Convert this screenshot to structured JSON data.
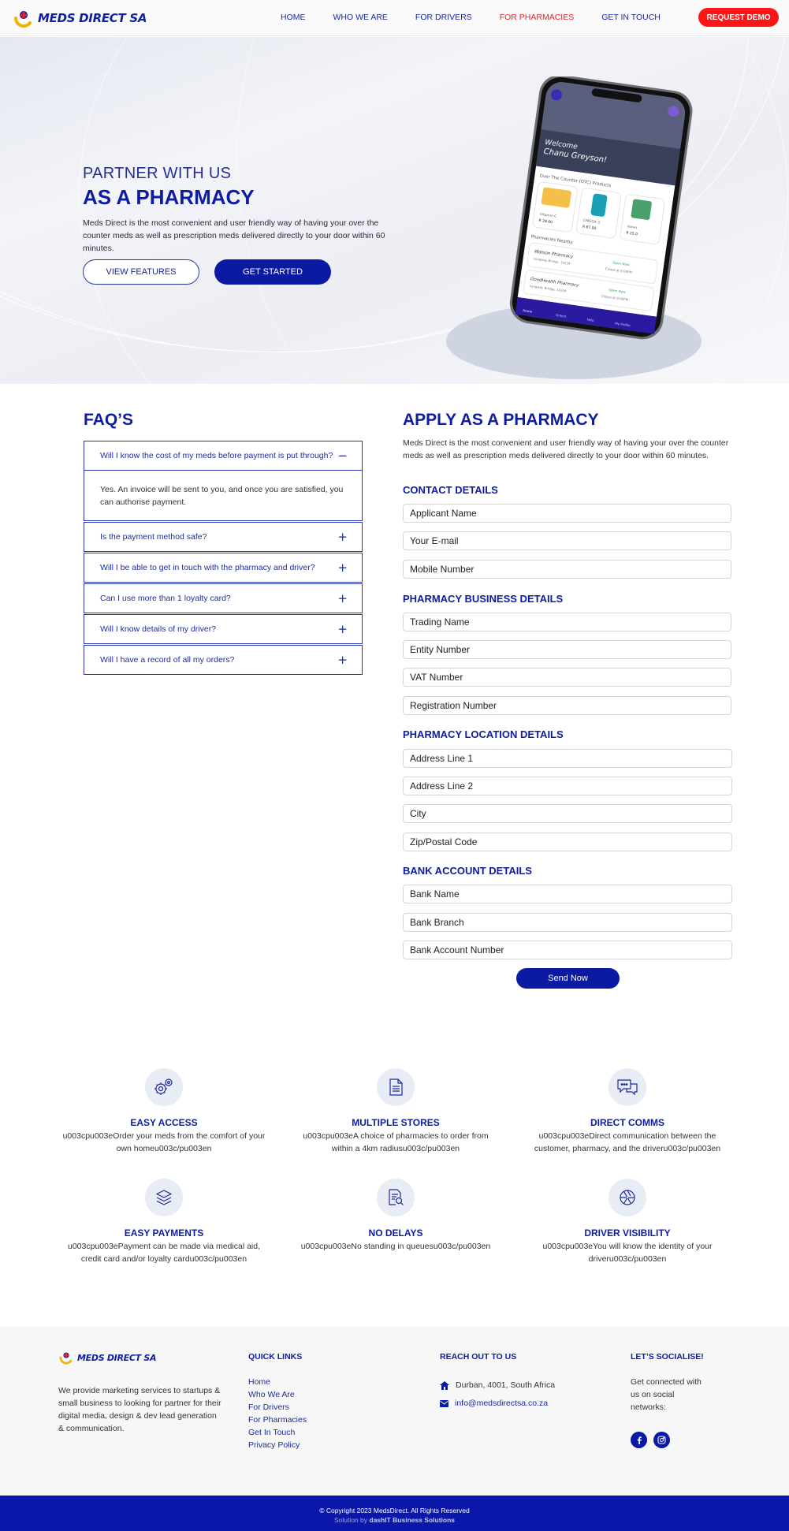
{
  "brand": {
    "name": "MEDS DIRECT SA"
  },
  "nav": {
    "items": [
      {
        "label": "HOME"
      },
      {
        "label": "WHO WE ARE"
      },
      {
        "label": "FOR DRIVERS"
      },
      {
        "label": "FOR PHARMACIES",
        "active": true
      },
      {
        "label": "GET IN TOUCH"
      }
    ],
    "cta": "REQUEST DEMO"
  },
  "hero": {
    "kicker": "PARTNER WITH US",
    "title": "AS A PHARMACY",
    "description": "Meds Direct is the most convenient and user friendly way of having your over the counter meds as well as prescription meds delivered directly to your door within 60 minutes.",
    "btn_features": "VIEW FEATURES",
    "btn_start": "GET STARTED"
  },
  "phone": {
    "welcome": "Welcome",
    "user": "Chanu Greyson!",
    "otc_heading": "Over The Counter (OTC) Products",
    "products": [
      {
        "name": "Vitamin C",
        "price": "R 28.00"
      },
      {
        "name": "OMEGA 3",
        "price": "R 87.00"
      },
      {
        "name": "Voren",
        "price": "R 25.0"
      }
    ],
    "nearby_heading": "Pharmacies Nearby",
    "pharmacies": [
      {
        "name": "Watson Pharmacy",
        "address": "Longway Bridge, 10234",
        "status": "Open Now",
        "closes": "Closes at 8:00PM"
      },
      {
        "name": "GoodHealth Pharmacy",
        "address": "Longway Bridge, 10234",
        "status": "Open Now",
        "closes": "Closes at 8:00PM"
      }
    ],
    "tabs": [
      "Home",
      "Orders",
      "Help",
      "My Profile"
    ]
  },
  "faq": {
    "title": "FAQ’S",
    "items": [
      {
        "q": "Will I know the cost of my meds before payment is put through?",
        "a": "Yes. An invoice will be sent to you, and once you are satisfied, you can authorise payment.",
        "open": true
      },
      {
        "q": "Is the payment method safe?"
      },
      {
        "q": "Will I be able to get in touch with the pharmacy and driver?"
      },
      {
        "q": "Can I use more than 1 loyalty card?"
      },
      {
        "q": "Will I know details of my driver?"
      },
      {
        "q": "Will I have a record of all my orders?"
      }
    ]
  },
  "apply": {
    "title": "APPLY AS A PHARMACY",
    "description": "Meds Direct is the most convenient and user friendly way of having your over the counter meds as well as prescription meds delivered directly to your door within 60 minutes.",
    "sections": [
      {
        "heading": "CONTACT DETAILS",
        "fields": [
          "Applicant Name",
          "Your E-mail",
          "Mobile Number"
        ]
      },
      {
        "heading": "PHARMACY BUSINESS DETAILS",
        "fields": [
          "Trading Name",
          "Entity Number",
          "VAT Number",
          "Registration Number"
        ]
      },
      {
        "heading": "PHARMACY LOCATION DETAILS",
        "fields": [
          "Address Line 1",
          "Address Line 2",
          "City",
          "Zip/Postal Code"
        ]
      },
      {
        "heading": "BANK ACCOUNT DETAILS",
        "fields": [
          "Bank Name",
          "Bank Branch",
          "Bank Account Number"
        ]
      }
    ],
    "submit": "Send Now"
  },
  "features": [
    {
      "icon": "gears-icon",
      "title": "EASY ACCESS",
      "line1": "u003cpu003eOrder your meds from the comfort of your",
      "line2": "own homeu003c/pu003en"
    },
    {
      "icon": "document-icon",
      "title": "MULTIPLE STORES",
      "line1": "u003cpu003eA choice of pharmacies to order from",
      "line2": "within a 4km radiusu003c/pu003en"
    },
    {
      "icon": "chat-icon",
      "title": "DIRECT COMMS",
      "line1": "u003cpu003eDirect communication between the",
      "line2": "customer, pharmacy, and the driveru003c/pu003en"
    },
    {
      "icon": "layers-icon",
      "title": "EASY PAYMENTS",
      "line1": "u003cpu003ePayment can be made via medical aid,",
      "line2": "credit card and/or loyalty cardu003c/pu003en"
    },
    {
      "icon": "search-document-icon",
      "title": "NO DELAYS",
      "line1": "u003cpu003eNo standing in queuesu003c/pu003en",
      "line2": ""
    },
    {
      "icon": "aperture-icon",
      "title": "DRIVER VISIBILITY",
      "line1": "u003cpu003eYou will know the identity of your",
      "line2": "driveru003c/pu003en"
    }
  ],
  "footer": {
    "about": "We provide marketing services to startups & small business to looking for partner for their digital media, design & dev lead generation & communication.",
    "quick_links_heading": "QUICK LINKS",
    "quick_links": [
      "Home",
      "Who We Are",
      "For Drivers",
      "For Pharmacies",
      "Get In Touch",
      "Privacy Policy"
    ],
    "reach_heading": "REACH OUT TO US",
    "address": "Durban, 4001, South Africa",
    "email": "info@medsdirectsa.co.za",
    "social_heading": "LET’S SOCIALISE!",
    "social_text": "Get connected with us on social networks:",
    "copyright": "© Copyright 2023 MedsDirect. All Rights Reserved",
    "solution_prefix": "Solution by",
    "solution_by": "dashIT Business Solutions"
  },
  "colors": {
    "brand_blue": "#0a1aa3",
    "accent_red": "#ff1418",
    "active_nav": "#e8232b"
  }
}
